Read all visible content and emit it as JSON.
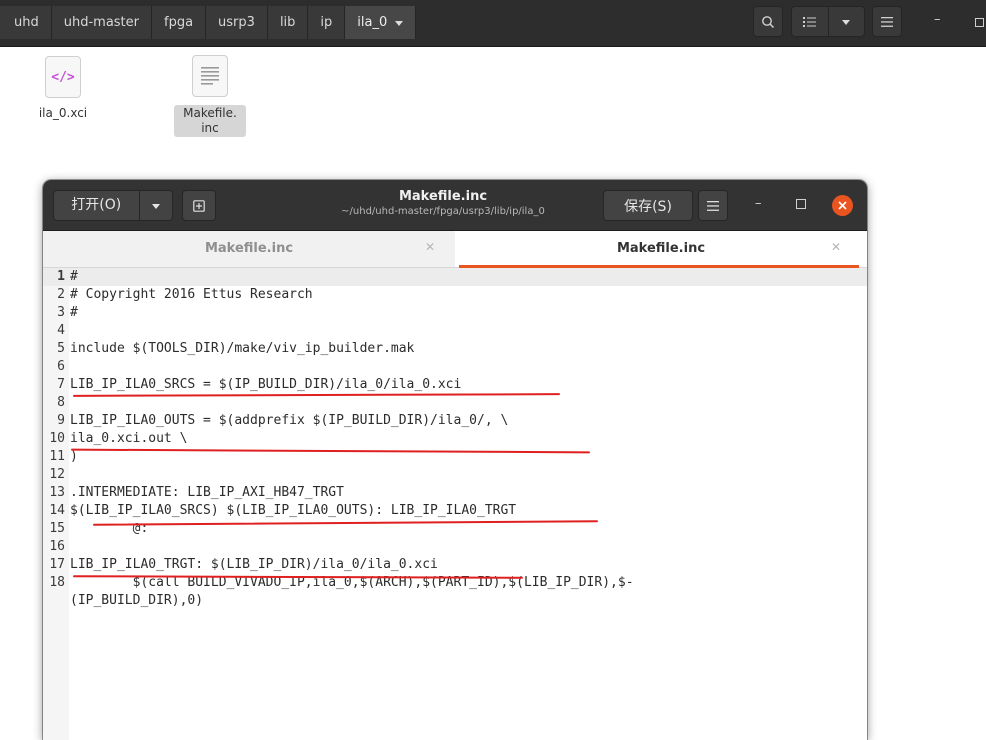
{
  "file_manager": {
    "breadcrumbs": [
      "uhd",
      "uhd-master",
      "fpga",
      "usrp3",
      "lib",
      "ip",
      "ila_0"
    ],
    "files": [
      {
        "name": "ila_0.xci",
        "icon": "xml-file-icon",
        "selected": false
      },
      {
        "name": "Makefile.\ninc",
        "icon": "text-file-icon",
        "selected": true
      }
    ]
  },
  "editor": {
    "open_label": "打开(O)",
    "save_label": "保存(S)",
    "title": "Makefile.inc",
    "subtitle": "~/uhd/uhd-master/fpga/usrp3/lib/ip/ila_0",
    "tabs": [
      {
        "label": "Makefile.inc",
        "active": false
      },
      {
        "label": "Makefile.inc",
        "active": true
      }
    ],
    "lines": [
      {
        "n": "1",
        "text": "#"
      },
      {
        "n": "2",
        "text": "# Copyright 2016 Ettus Research"
      },
      {
        "n": "3",
        "text": "#"
      },
      {
        "n": "4",
        "text": ""
      },
      {
        "n": "5",
        "text": "include $(TOOLS_DIR)/make/viv_ip_builder.mak"
      },
      {
        "n": "6",
        "text": ""
      },
      {
        "n": "7",
        "text": "LIB_IP_ILA0_SRCS = $(IP_BUILD_DIR)/ila_0/ila_0.xci"
      },
      {
        "n": "8",
        "text": ""
      },
      {
        "n": "9",
        "text": "LIB_IP_ILA0_OUTS = $(addprefix $(IP_BUILD_DIR)/ila_0/, \\"
      },
      {
        "n": "10",
        "text": "ila_0.xci.out \\"
      },
      {
        "n": "11",
        "text": ")"
      },
      {
        "n": "12",
        "text": ""
      },
      {
        "n": "13",
        "text": ".INTERMEDIATE: LIB_IP_AXI_HB47_TRGT"
      },
      {
        "n": "14",
        "text": "$(LIB_IP_ILA0_SRCS) $(LIB_IP_ILA0_OUTS): LIB_IP_ILA0_TRGT"
      },
      {
        "n": "15",
        "text": "        @:"
      },
      {
        "n": "16",
        "text": ""
      },
      {
        "n": "17",
        "text": "LIB_IP_ILA0_TRGT: $(LIB_IP_DIR)/ila_0/ila_0.xci"
      },
      {
        "n": "18",
        "text": "        $(call BUILD_VIVADO_IP,ila_0,$(ARCH),$(PART_ID),$(LIB_IP_DIR),$-"
      },
      {
        "n": "",
        "text": "(IP_BUILD_DIR),0)"
      }
    ]
  },
  "colors": {
    "accent": "#e95420",
    "annotation": "#e02020",
    "header_dark": "#2d2d2d"
  }
}
